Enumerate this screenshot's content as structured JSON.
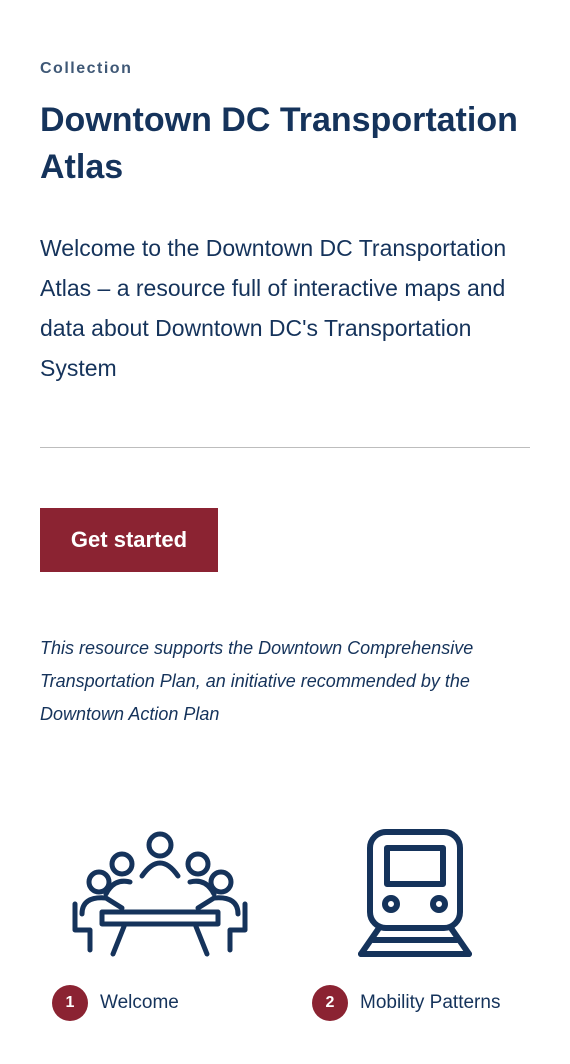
{
  "header": {
    "eyebrow": "Collection",
    "title": "Downtown DC Transportation Atlas"
  },
  "intro": "Welcome to the Downtown DC Transportation Atlas – a resource full of interactive maps and data about Downtown DC's Transportation System",
  "cta": {
    "label": "Get started"
  },
  "note": "This resource supports the Downtown Comprehensive Transportation Plan, an initiative recommended by the Downtown Action Plan",
  "cards": [
    {
      "number": "1",
      "label": "Welcome",
      "icon": "meeting-table-icon"
    },
    {
      "number": "2",
      "label": "Mobility Patterns",
      "icon": "train-icon"
    }
  ],
  "colors": {
    "navy": "#15335b",
    "accent": "#8b2332",
    "divider": "#bdbdbd"
  }
}
